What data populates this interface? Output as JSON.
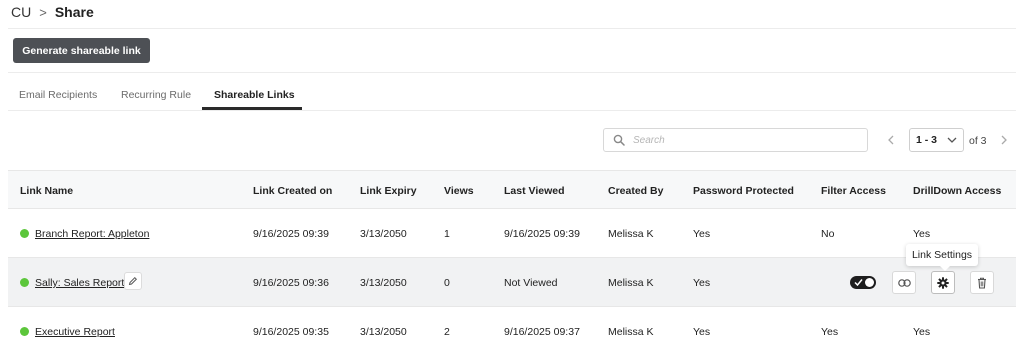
{
  "breadcrumb": {
    "root": "CU",
    "separator": ">",
    "current": "Share"
  },
  "toolbar": {
    "generate_label": "Generate shareable link"
  },
  "tabs": [
    {
      "label": "Email Recipients",
      "active": false
    },
    {
      "label": "Recurring Rule",
      "active": false
    },
    {
      "label": "Shareable Links",
      "active": true
    }
  ],
  "search": {
    "placeholder": "Search",
    "value": ""
  },
  "pagination": {
    "range": "1 - 3",
    "of_label": "of 3"
  },
  "table": {
    "headers": [
      "Link Name",
      "Link Created on",
      "Link Expiry",
      "Views",
      "Last Viewed",
      "Created By",
      "Password Protected",
      "Filter Access",
      "DrillDown Access"
    ],
    "rows": [
      {
        "name": "Branch Report: Appleton",
        "created": "9/16/2025 09:39",
        "expiry": "3/13/2050",
        "views": "1",
        "last_viewed": "9/16/2025 09:39",
        "created_by": "Melissa K",
        "password": "Yes",
        "filter": "No",
        "drilldown": "Yes",
        "status": "active"
      },
      {
        "name": "Sally: Sales Report",
        "created": "9/16/2025 09:36",
        "expiry": "3/13/2050",
        "views": "0",
        "last_viewed": "Not Viewed",
        "created_by": "Melissa K",
        "password": "Yes",
        "filter": "",
        "drilldown": "",
        "status": "active"
      },
      {
        "name": "Executive Report",
        "created": "9/16/2025 09:35",
        "expiry": "3/13/2050",
        "views": "2",
        "last_viewed": "9/16/2025 09:37",
        "created_by": "Melissa K",
        "password": "Yes",
        "filter": "Yes",
        "drilldown": "Yes",
        "status": "active"
      }
    ]
  },
  "row_actions": {
    "tooltip": "Link Settings",
    "toggle_on": true
  },
  "colors": {
    "status_active": "#5cc63b",
    "primary_button": "#4d5055",
    "toggle": "#1e1e1e"
  },
  "icons": {
    "search": "search-icon",
    "edit": "pencil-icon",
    "link": "link-icon",
    "settings": "gear-icon",
    "delete": "trash-icon",
    "prev": "chevron-left-icon",
    "next": "chevron-right-icon",
    "dropdown": "chevron-down-icon"
  }
}
